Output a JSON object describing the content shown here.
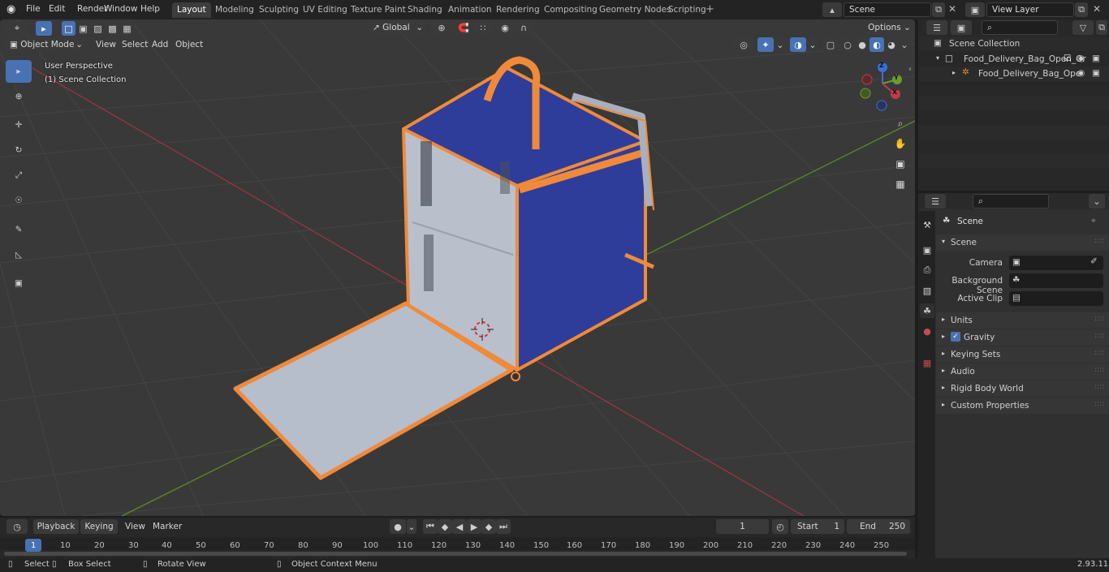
{
  "topbar": {
    "menus": [
      "File",
      "Edit",
      "Render",
      "Window",
      "Help"
    ],
    "workspaces": [
      "Layout",
      "Modeling",
      "Sculpting",
      "UV Editing",
      "Texture Paint",
      "Shading",
      "Animation",
      "Rendering",
      "Compositing",
      "Geometry Nodes",
      "Scripting"
    ],
    "active_workspace": "Layout",
    "scene_name": "Scene",
    "view_layer_name": "View Layer"
  },
  "viewport": {
    "mode": "Object Mode",
    "menus": [
      "View",
      "Select",
      "Add",
      "Object"
    ],
    "transform_orientation": "Global",
    "options_label": "Options",
    "overlay_line1": "User Perspective",
    "overlay_line2": "(1) Scene Collection",
    "gizmo_axes": {
      "x": "X",
      "y": "Y",
      "z": "Z"
    },
    "colors": {
      "background": "#393939",
      "x_axis": "#b53a45",
      "y_axis": "#6e9a2c",
      "selection": "#f08a3a",
      "bag_blue": "#2f3d9a",
      "bag_gray": "#b9c0cc"
    }
  },
  "outliner": {
    "root": "Scene Collection",
    "items": [
      {
        "label": "Food_Delivery_Bag_Open_Or"
      },
      {
        "label": "Food_Delivery_Bag_Ope"
      }
    ]
  },
  "properties": {
    "header_title": "Scene",
    "panel_title": "Scene",
    "camera_label": "Camera",
    "background_scene_label": "Background Scene",
    "active_clip_label": "Active Clip",
    "sections": [
      "Units",
      "Gravity",
      "Keying Sets",
      "Audio",
      "Rigid Body World",
      "Custom Properties"
    ]
  },
  "timeline": {
    "menus": [
      "Playback",
      "Keying",
      "View",
      "Marker"
    ],
    "current_frame": "1",
    "start_label": "Start",
    "start_value": "1",
    "end_label": "End",
    "end_value": "250",
    "ruler": [
      "1",
      "10",
      "20",
      "30",
      "40",
      "50",
      "60",
      "70",
      "80",
      "90",
      "100",
      "110",
      "120",
      "130",
      "140",
      "150",
      "160",
      "170",
      "180",
      "190",
      "200",
      "210",
      "220",
      "230",
      "240",
      "250"
    ]
  },
  "statusbar": {
    "select": "Select",
    "box_select": "Box Select",
    "rotate_view": "Rotate View",
    "context_menu": "Object Context Menu",
    "version": "2.93.11"
  }
}
